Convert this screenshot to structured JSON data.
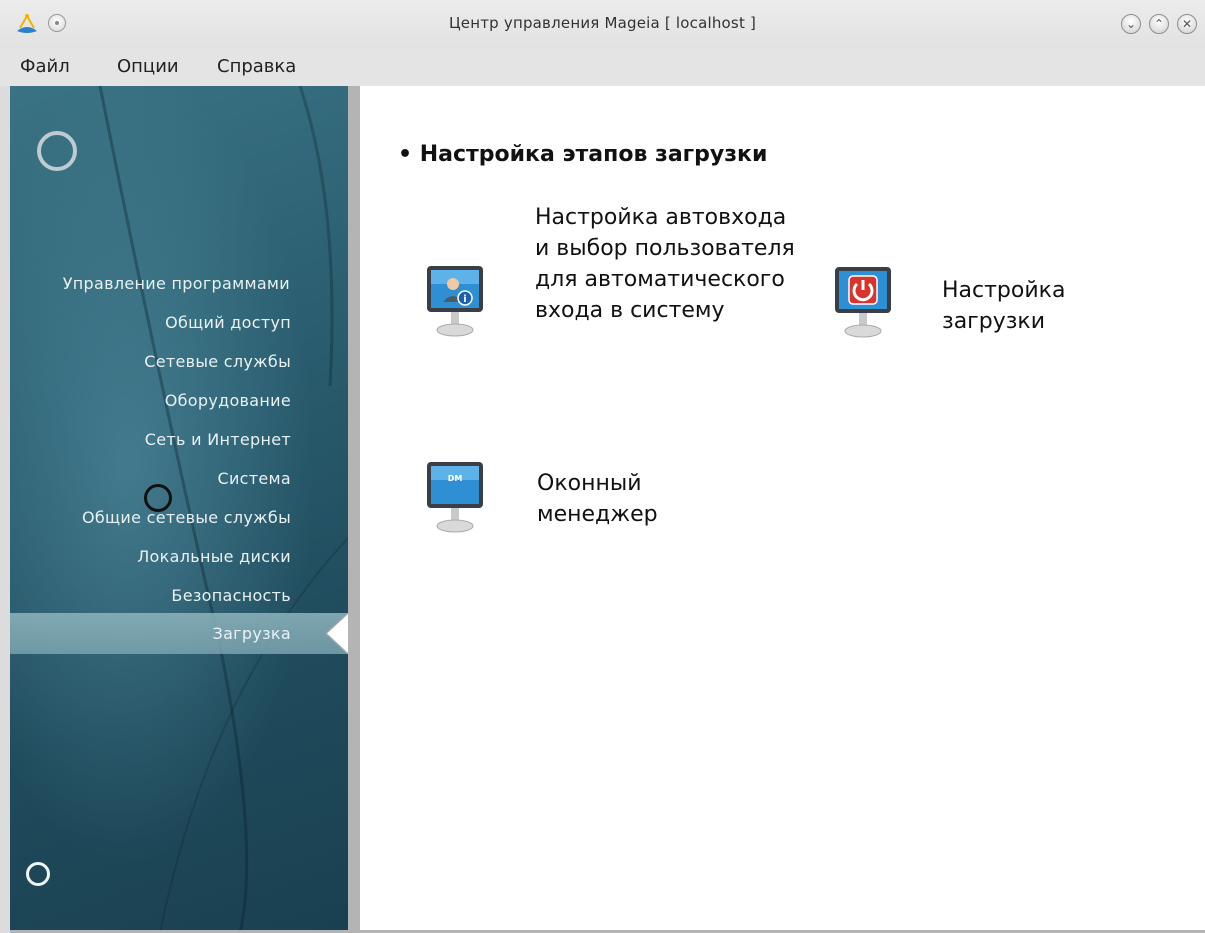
{
  "window": {
    "title": "Центр управления Mageia  [ localhost ]",
    "buttons": [
      "minimize-icon",
      "maximize-icon",
      "close-icon"
    ]
  },
  "menu": {
    "file": "Файл",
    "options": "Опции",
    "help": "Справка"
  },
  "sidebar": {
    "items": [
      {
        "label": "Управление программами"
      },
      {
        "label": "Общий доступ"
      },
      {
        "label": "Сетевые службы"
      },
      {
        "label": "Оборудование"
      },
      {
        "label": "Сеть и Интернет"
      },
      {
        "label": "Система"
      },
      {
        "label": "Общие сетевые службы"
      },
      {
        "label": "Локальные диски"
      },
      {
        "label": "Безопасность"
      },
      {
        "label": "Загрузка",
        "selected": true
      }
    ]
  },
  "main": {
    "section_title": "Настройка этапов загрузки",
    "tools": [
      {
        "label": "Настройка автовхода и выбор пользователя для автоматического входа в систему",
        "icon": "autologin-monitor-icon"
      },
      {
        "label": "Настройка загрузки",
        "icon": "boot-power-monitor-icon"
      },
      {
        "label": "Оконный менеджер",
        "icon": "display-manager-monitor-icon",
        "icon_text": "DM"
      }
    ]
  },
  "colors": {
    "sidebar": "#2a5e70",
    "selected_item": "#8fb5bf",
    "boot_icon_red": "#d9342b",
    "monitor_blue": "#2f8fd4"
  }
}
